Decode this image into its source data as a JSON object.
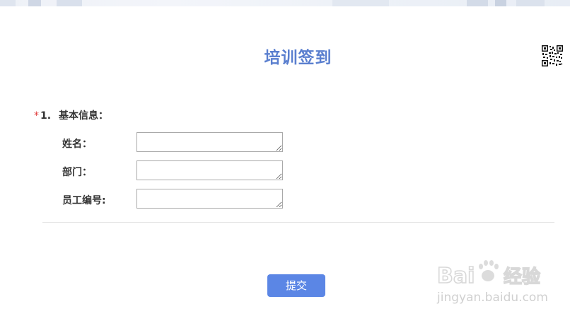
{
  "form": {
    "title": "培训签到",
    "question": {
      "required_mark": "*",
      "number": "1.",
      "title": "基本信息："
    },
    "fields": [
      {
        "label": "姓名：",
        "value": ""
      },
      {
        "label": "部门：",
        "value": ""
      },
      {
        "label": "员工编号:",
        "value": ""
      }
    ],
    "submit_label": "提交"
  },
  "watermark": {
    "logo_text": "Bai",
    "logo_text_2": "经验",
    "url_text": "jingyan.baidu.com"
  },
  "colors": {
    "title": "#5a7fcf",
    "submit_button": "#5b86e5",
    "required_mark": "#e03a3a"
  },
  "icons": {
    "qr": "qr-code-icon",
    "watermark_paw": "paw-icon"
  }
}
